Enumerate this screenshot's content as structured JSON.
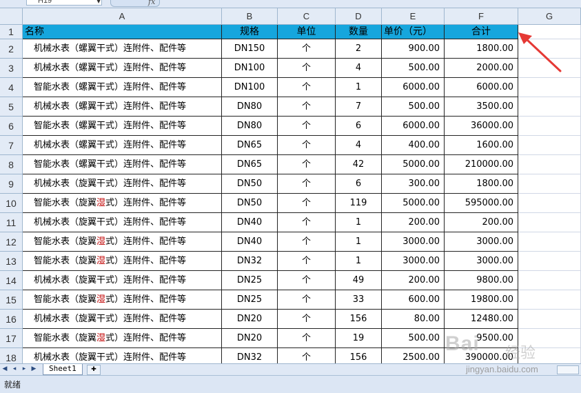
{
  "namebox": {
    "value": "H19"
  },
  "formula": {
    "fx_label": "fx"
  },
  "column_headers": [
    "A",
    "B",
    "C",
    "D",
    "E",
    "F",
    "G"
  ],
  "row_numbers": [
    "1",
    "2",
    "3",
    "4",
    "5",
    "6",
    "7",
    "8",
    "9",
    "10",
    "11",
    "12",
    "13",
    "14",
    "15",
    "16",
    "17",
    "18"
  ],
  "table": {
    "header": {
      "name": "名称",
      "spec": "规格",
      "unit": "单位",
      "qty": "数量",
      "price": "单价（元）",
      "total": "合计"
    },
    "rows": [
      {
        "name_pre": "机械水表（螺翼干式）连附件、配件等",
        "name_red": "",
        "name_post": "",
        "spec": "DN150",
        "unit": "个",
        "qty": "2",
        "price": "900.00",
        "total": "1800.00"
      },
      {
        "name_pre": "机械水表（螺翼干式）连附件、配件等",
        "name_red": "",
        "name_post": "",
        "spec": "DN100",
        "unit": "个",
        "qty": "4",
        "price": "500.00",
        "total": "2000.00"
      },
      {
        "name_pre": "智能水表（螺翼干式）连附件、配件等",
        "name_red": "",
        "name_post": "",
        "spec": "DN100",
        "unit": "个",
        "qty": "1",
        "price": "6000.00",
        "total": "6000.00"
      },
      {
        "name_pre": "机械水表（螺翼干式）连附件、配件等",
        "name_red": "",
        "name_post": "",
        "spec": "DN80",
        "unit": "个",
        "qty": "7",
        "price": "500.00",
        "total": "3500.00"
      },
      {
        "name_pre": "智能水表（螺翼干式）连附件、配件等",
        "name_red": "",
        "name_post": "",
        "spec": "DN80",
        "unit": "个",
        "qty": "6",
        "price": "6000.00",
        "total": "36000.00"
      },
      {
        "name_pre": "机械水表（螺翼干式）连附件、配件等",
        "name_red": "",
        "name_post": "",
        "spec": "DN65",
        "unit": "个",
        "qty": "4",
        "price": "400.00",
        "total": "1600.00"
      },
      {
        "name_pre": "智能水表（螺翼干式）连附件、配件等",
        "name_red": "",
        "name_post": "",
        "spec": "DN65",
        "unit": "个",
        "qty": "42",
        "price": "5000.00",
        "total": "210000.00"
      },
      {
        "name_pre": "机械水表（旋翼干式）连附件、配件等",
        "name_red": "",
        "name_post": "",
        "spec": "DN50",
        "unit": "个",
        "qty": "6",
        "price": "300.00",
        "total": "1800.00"
      },
      {
        "name_pre": "智能水表（旋翼",
        "name_red": "湿",
        "name_post": "式）连附件、配件等",
        "spec": "DN50",
        "unit": "个",
        "qty": "119",
        "price": "5000.00",
        "total": "595000.00"
      },
      {
        "name_pre": "机械水表（旋翼干式）连附件、配件等",
        "name_red": "",
        "name_post": "",
        "spec": "DN40",
        "unit": "个",
        "qty": "1",
        "price": "200.00",
        "total": "200.00"
      },
      {
        "name_pre": "智能水表（旋翼",
        "name_red": "湿",
        "name_post": "式）连附件、配件等",
        "spec": "DN40",
        "unit": "个",
        "qty": "1",
        "price": "3000.00",
        "total": "3000.00"
      },
      {
        "name_pre": "智能水表（旋翼",
        "name_red": "湿",
        "name_post": "式）连附件、配件等",
        "spec": "DN32",
        "unit": "个",
        "qty": "1",
        "price": "3000.00",
        "total": "3000.00"
      },
      {
        "name_pre": "机械水表（旋翼干式）连附件、配件等",
        "name_red": "",
        "name_post": "",
        "spec": "DN25",
        "unit": "个",
        "qty": "49",
        "price": "200.00",
        "total": "9800.00"
      },
      {
        "name_pre": "智能水表（旋翼",
        "name_red": "湿",
        "name_post": "式）连附件、配件等",
        "spec": "DN25",
        "unit": "个",
        "qty": "33",
        "price": "600.00",
        "total": "19800.00"
      },
      {
        "name_pre": "机械水表（旋翼干式）连附件、配件等",
        "name_red": "",
        "name_post": "",
        "spec": "DN20",
        "unit": "个",
        "qty": "156",
        "price": "80.00",
        "total": "12480.00"
      },
      {
        "name_pre": "智能水表（旋翼",
        "name_red": "湿",
        "name_post": "式）连附件、配件等",
        "spec": "DN20",
        "unit": "个",
        "qty": "19",
        "price": "500.00",
        "total": "9500.00"
      },
      {
        "name_pre": "机械水表（旋翼干式）连附件、配件等",
        "name_red": "",
        "name_post": "",
        "spec": "DN32",
        "unit": "个",
        "qty": "156",
        "price": "2500.00",
        "total": "390000.00"
      }
    ]
  },
  "sheet_tabs": [
    "Sheet1"
  ],
  "status": {
    "text": "就绪"
  },
  "watermark": {
    "logo": "Bai",
    "text": "经验",
    "url": "jingyan.baidu.com"
  },
  "colors": {
    "header_fill": "#16a6dd",
    "red_text": "#c00000",
    "arrow": "#e53935"
  }
}
